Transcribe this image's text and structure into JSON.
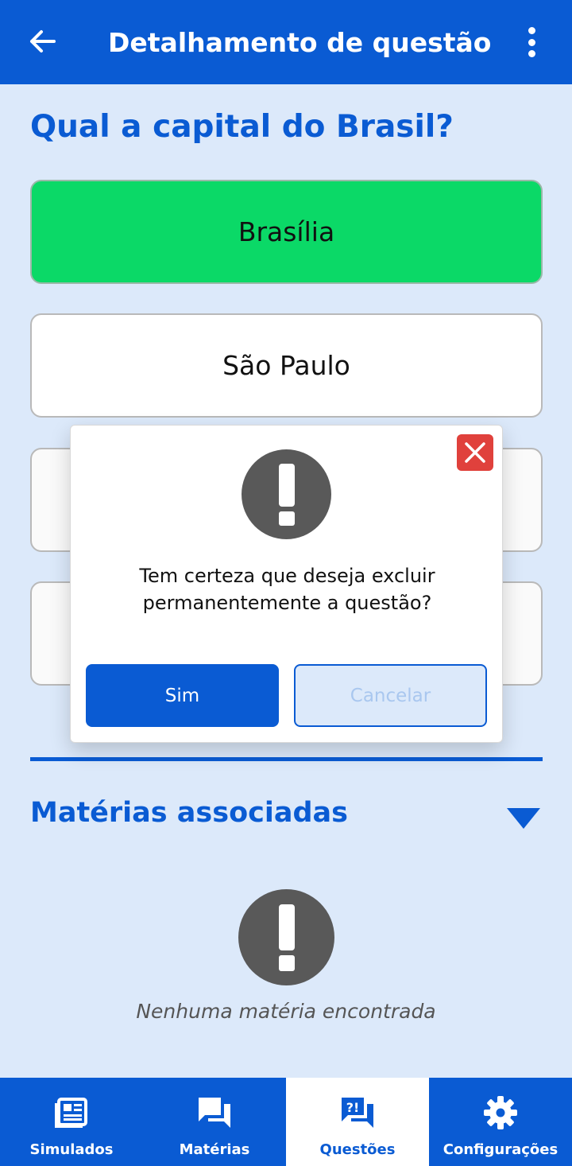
{
  "app_bar": {
    "title": "Detalhamento de questão",
    "back_icon": "arrow-left-icon",
    "menu_icon": "more-vertical-icon"
  },
  "question": {
    "text": "Qual a capital do Brasil?",
    "options": [
      {
        "label": "Brasília",
        "correct": true
      },
      {
        "label": "São Paulo",
        "correct": false
      },
      {
        "label": "",
        "correct": false
      },
      {
        "label": "",
        "correct": false
      }
    ]
  },
  "section": {
    "title": "Matérias associadas",
    "toggle_icon": "triangle-down-icon",
    "empty_icon": "exclamation-circle-icon",
    "empty_text": "Nenhuma matéria encontrada"
  },
  "dialog": {
    "icon": "exclamation-circle-icon",
    "close_icon": "close-icon",
    "message": "Tem certeza que deseja excluir permanentemente a questão?",
    "confirm_label": "Sim",
    "cancel_label": "Cancelar"
  },
  "bottom_nav": {
    "active": "Questões",
    "items": [
      {
        "label": "Simulados",
        "icon": "newspaper-icon"
      },
      {
        "label": "Matérias",
        "icon": "chat-bubbles-icon"
      },
      {
        "label": "Questões",
        "icon": "question-chat-icon"
      },
      {
        "label": "Configurações",
        "icon": "gear-icon"
      }
    ]
  },
  "colors": {
    "primary": "#0a5bd3",
    "background": "#dce9fa",
    "correct": "#0bd967",
    "danger": "#e0413c",
    "icon_gray": "#595959"
  }
}
